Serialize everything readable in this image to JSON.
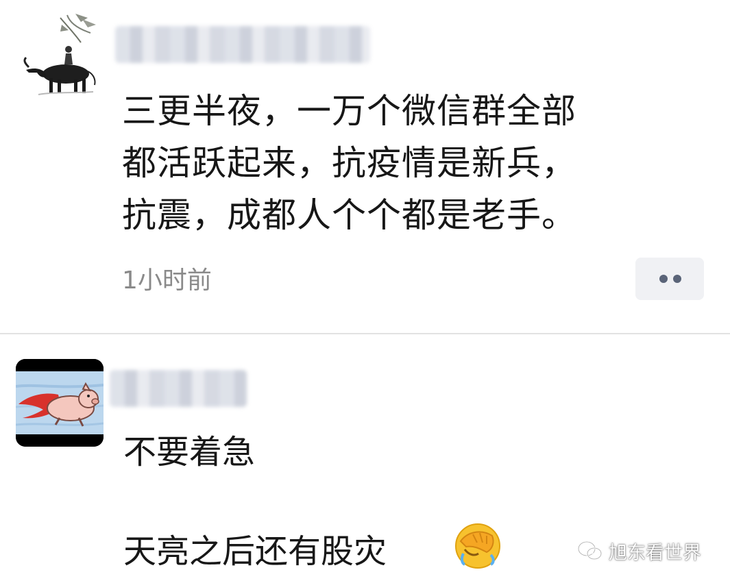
{
  "posts": [
    {
      "author_blurred": true,
      "avatar": "ink-painting-buffalo-rider-avatar",
      "text": "三更半夜，一万个微信群全部\n都活跃起来，抗疫情是新兵，\n抗震，成都人个个都是老手。",
      "time": "1小时前",
      "more_icon": "two-dots-more-icon"
    },
    {
      "author_blurred": true,
      "avatar": "flying-pig-cape-avatar",
      "line1": "不要着急",
      "line2": "天亮之后还有股灾",
      "emoji": "facepalm-crying-emoji"
    }
  ],
  "watermark": {
    "icon": "wechat-icon",
    "text": "旭东看世界"
  },
  "colors": {
    "timestamp": "#8a8a8a",
    "more_button_bg": "#f0f1f4",
    "divider": "#e2e2e2"
  }
}
